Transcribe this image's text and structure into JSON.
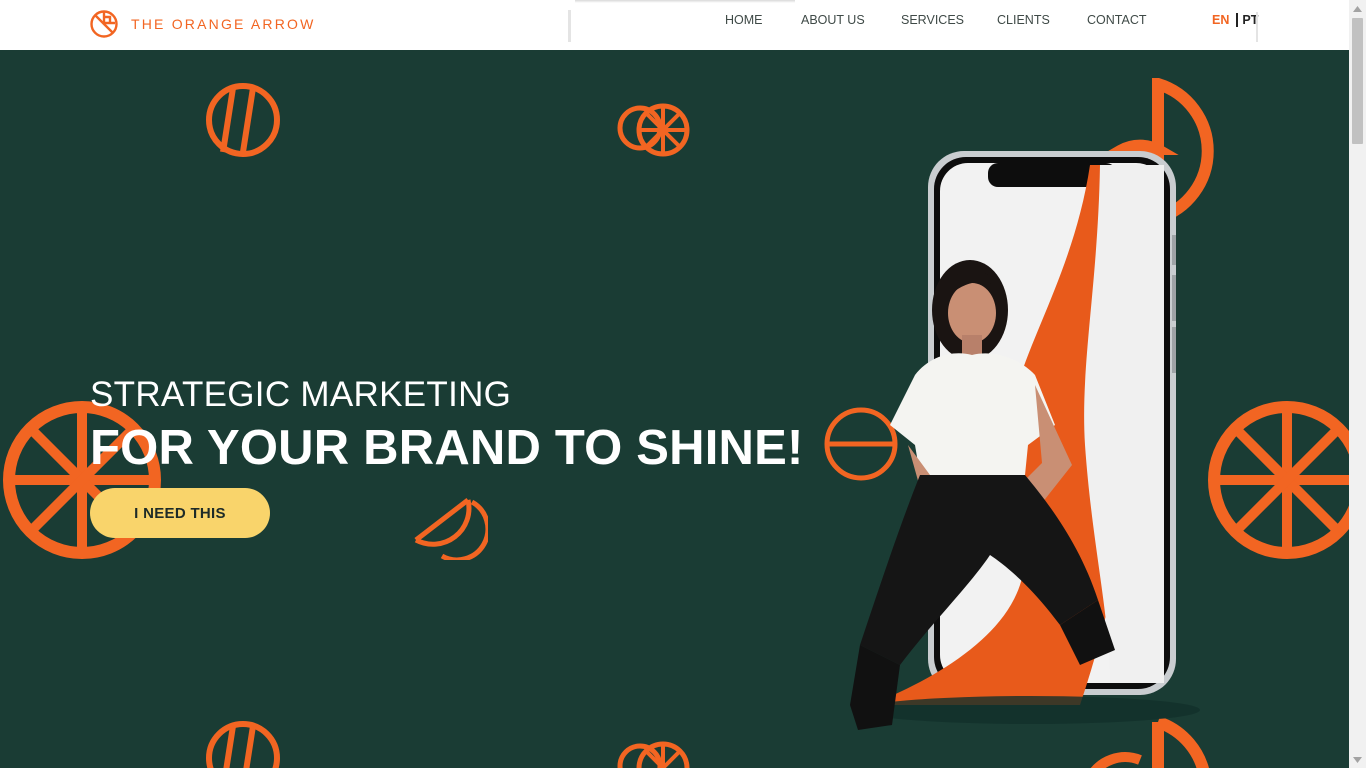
{
  "brand": {
    "name": "THE ORANGE ARROW",
    "logo_icon": "orange-arrow-logo-icon"
  },
  "nav": {
    "items": [
      {
        "label": "HOME"
      },
      {
        "label": "ABOUT US"
      },
      {
        "label": "SERVICES"
      },
      {
        "label": "CLIENTS"
      },
      {
        "label": "CONTACT"
      }
    ]
  },
  "language": {
    "active": "EN",
    "other": "PT"
  },
  "hero": {
    "subtitle": "STRATEGIC MARKETING",
    "title": "FOR YOUR BRAND TO SHINE!",
    "cta_label": "I NEED THIS"
  },
  "colors": {
    "accent": "#f26522",
    "hero_background": "#1a3c34",
    "cta_background": "#f9d46b",
    "nav_text": "#3f4a47"
  }
}
